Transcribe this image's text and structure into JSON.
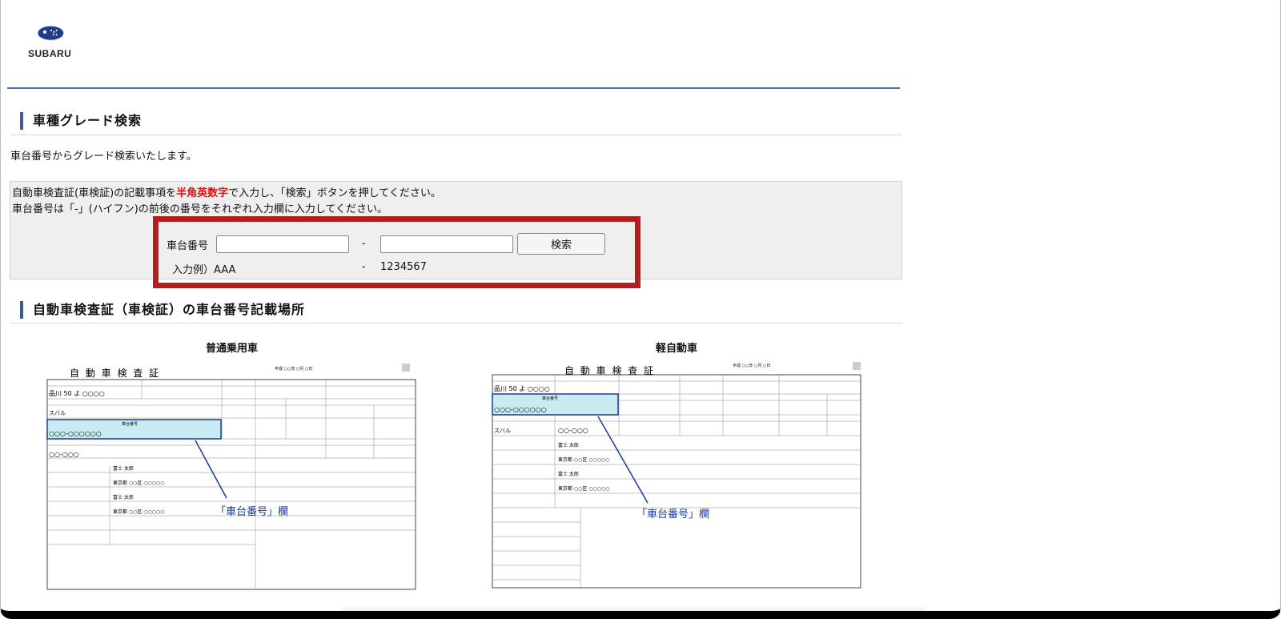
{
  "brand": {
    "logo_text": "SUBARU"
  },
  "section1": {
    "title": "車種グレード検索"
  },
  "intro": "車台番号からグレード検索いたします。",
  "instructions": {
    "line1_pre": "自動車検査証(車検証)の記載事項を",
    "line1_red": "半角英数字",
    "line1_post": "で入力し、「検索」ボタンを押してください。",
    "line2": "車台番号は「-」(ハイフン)の前後の番号をそれぞれ入力欄に入力してください。"
  },
  "search": {
    "label": "車台番号",
    "hyphen": "-",
    "part1_value": "",
    "part2_value": "",
    "button_label": "検索",
    "example_label": "入力例）AAA",
    "example_hyphen": "-",
    "example_part2": "1234567"
  },
  "section2": {
    "title": "自動車検査証（車検証）の車台番号記載場所"
  },
  "examples": [
    {
      "label": "普通乗用車",
      "cert_title": "自 動 車 検 査 証",
      "date": "平成 ○○年 ○月 ○日",
      "number": "品川 50 よ ○○○○",
      "car_name": "スバル",
      "chassis_header": "車台番号",
      "chassis_value": "○○○-○○○○○○",
      "model": "○○-○○○",
      "owner": "富士 太郎",
      "address": "東京都 ○○区 ○○○○○",
      "callout": "「車台番号」欄"
    },
    {
      "label": "軽自動車",
      "cert_title": "自 動 車 検 査 証",
      "date": "平成 ○○年 ○月 ○日",
      "number": "品川 50 よ ○○○○",
      "car_name": "スバル",
      "chassis_header": "車台番号",
      "chassis_value": "○○○-○○○○○○",
      "model": "○○-○○○",
      "owner": "富士 太郎",
      "address": "東京都 ○○区 ○○○○○",
      "callout": "「車台番号」欄"
    }
  ],
  "colors": {
    "accent": "#3e5f8d",
    "header_line": "#4a72a8",
    "red_border": "#b81d1d",
    "highlight": "#c8ecf2",
    "callout": "#1a3a9a"
  }
}
